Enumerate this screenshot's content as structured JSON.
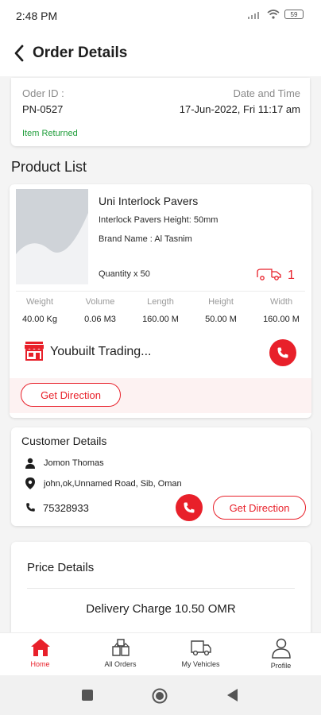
{
  "status_bar": {
    "time": "2:48 PM",
    "battery": "59"
  },
  "header": {
    "title": "Order Details"
  },
  "order": {
    "id_label": "Oder ID :",
    "id_value": "PN-0527",
    "date_label": "Date and Time",
    "date_value": "17-Jun-2022, Fri 11:17 am",
    "status": "Item Returned"
  },
  "product_list": {
    "title": "Product List",
    "product": {
      "name": "Uni Interlock Pavers",
      "spec": "Interlock Pavers Height: 50mm",
      "brand": "Brand Name : Al Tasnim",
      "quantity": "Quantity x 50",
      "truck_count": "1",
      "dimensions": [
        {
          "label": "Weight",
          "value": "40.00 Kg"
        },
        {
          "label": "Volume",
          "value": "0.06 M3"
        },
        {
          "label": "Length",
          "value": "160.00 M"
        },
        {
          "label": "Height",
          "value": "50.00 M"
        },
        {
          "label": "Width",
          "value": "160.00 M"
        }
      ],
      "shop_name": "Youbuilt Trading...",
      "direction_label": "Get Direction"
    }
  },
  "customer": {
    "title": "Customer Details",
    "name": "Jomon Thomas",
    "address": "john,ok,Unnamed Road, Sib, Oman",
    "phone": "75328933",
    "direction_label": "Get Direction"
  },
  "price": {
    "title": "Price Details",
    "delivery": "Delivery Charge 10.50 OMR"
  },
  "nav": {
    "items": [
      {
        "label": "Home",
        "icon": "home-icon"
      },
      {
        "label": "All Orders",
        "icon": "boxes-icon"
      },
      {
        "label": "My Vehicles",
        "icon": "truck-icon"
      },
      {
        "label": "Profile",
        "icon": "user-icon"
      }
    ],
    "active": "Home"
  },
  "colors": {
    "accent": "#e8202a",
    "success": "#1f9d3a"
  }
}
